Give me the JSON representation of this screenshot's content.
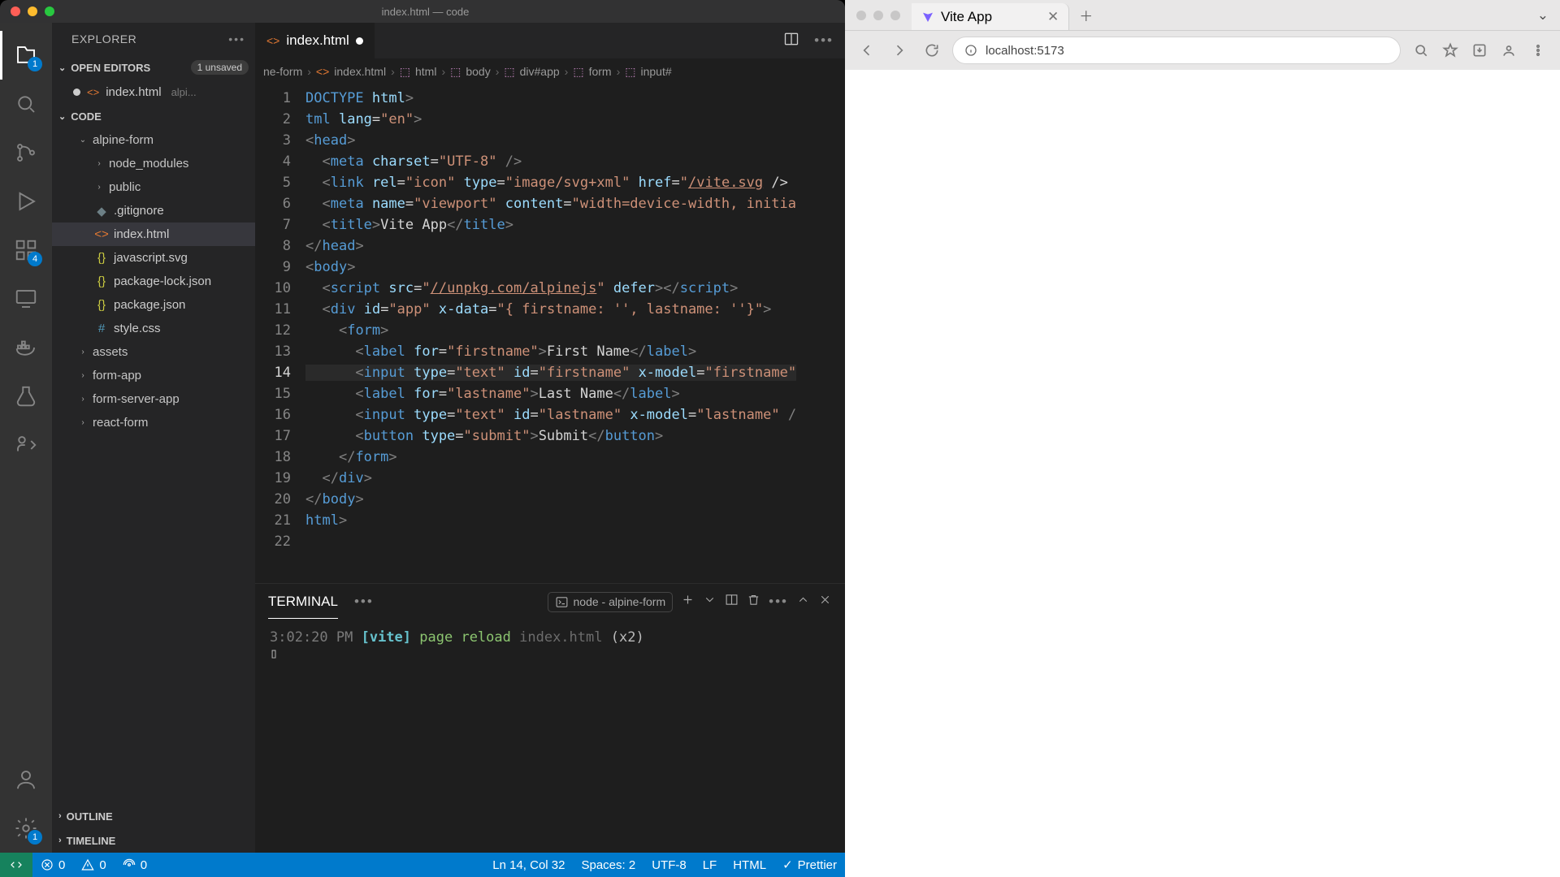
{
  "vscode": {
    "window_title": "index.html — code",
    "explorer": {
      "title": "EXPLORER",
      "open_editors_label": "OPEN EDITORS",
      "unsaved_badge": "1 unsaved",
      "open_file": {
        "name": "index.html",
        "dir": "alpi..."
      },
      "workspace_label": "CODE",
      "tree": [
        {
          "type": "folder",
          "name": "alpine-form",
          "depth": 1
        },
        {
          "type": "folder",
          "name": "node_modules",
          "depth": 2
        },
        {
          "type": "folder",
          "name": "public",
          "depth": 2
        },
        {
          "type": "file",
          "name": ".gitignore",
          "icon": "grey",
          "depth": 2
        },
        {
          "type": "file",
          "name": "index.html",
          "icon": "orange",
          "depth": 2,
          "selected": true
        },
        {
          "type": "file",
          "name": "javascript.svg",
          "icon": "yellow",
          "depth": 2
        },
        {
          "type": "file",
          "name": "package-lock.json",
          "icon": "yellow",
          "depth": 2
        },
        {
          "type": "file",
          "name": "package.json",
          "icon": "yellow",
          "depth": 2
        },
        {
          "type": "file",
          "name": "style.css",
          "icon": "blue",
          "depth": 2
        },
        {
          "type": "folder",
          "name": "assets",
          "depth": 1
        },
        {
          "type": "folder",
          "name": "form-app",
          "depth": 1
        },
        {
          "type": "folder",
          "name": "form-server-app",
          "depth": 1
        },
        {
          "type": "folder",
          "name": "react-form",
          "depth": 1
        }
      ],
      "outline_label": "OUTLINE",
      "timeline_label": "TIMELINE"
    },
    "activity_badges": {
      "explorer": "1",
      "ext": "4",
      "gear": "1"
    },
    "tab": {
      "name": "index.html"
    },
    "breadcrumb": {
      "seg0": "ne-form",
      "seg1": "index.html",
      "seg2": "html",
      "seg3": "body",
      "seg4": "div#app",
      "seg5": "form",
      "seg6": "input#"
    },
    "lines": [
      "1",
      "2",
      "3",
      "4",
      "5",
      "6",
      "7",
      "8",
      "9",
      "10",
      "11",
      "12",
      "13",
      "14",
      "15",
      "16",
      "17",
      "18",
      "19",
      "20",
      "21",
      "22"
    ],
    "active_line": "14",
    "code_tokens": {
      "vite_title": "Vite App",
      "first_name_label": "First Name",
      "last_name_label": "Last Name",
      "submit_label": "Submit",
      "alpine_url": "//unpkg.com/alpinejs",
      "vite_svg": "/vite.svg"
    },
    "terminal": {
      "tab_label": "TERMINAL",
      "process": "node - alpine-form",
      "time": "3:02:20 PM",
      "tag": "[vite]",
      "msg": "page reload",
      "file": "index.html",
      "count": "(x2)"
    },
    "status": {
      "errors": "0",
      "warnings": "0",
      "ports": "0",
      "ln": "Ln 14, Col 32",
      "spaces": "Spaces: 2",
      "enc": "UTF-8",
      "eol": "LF",
      "lang": "HTML",
      "fmt": "Prettier"
    }
  },
  "safari": {
    "tab_title": "Vite App",
    "url": "localhost:5173"
  }
}
